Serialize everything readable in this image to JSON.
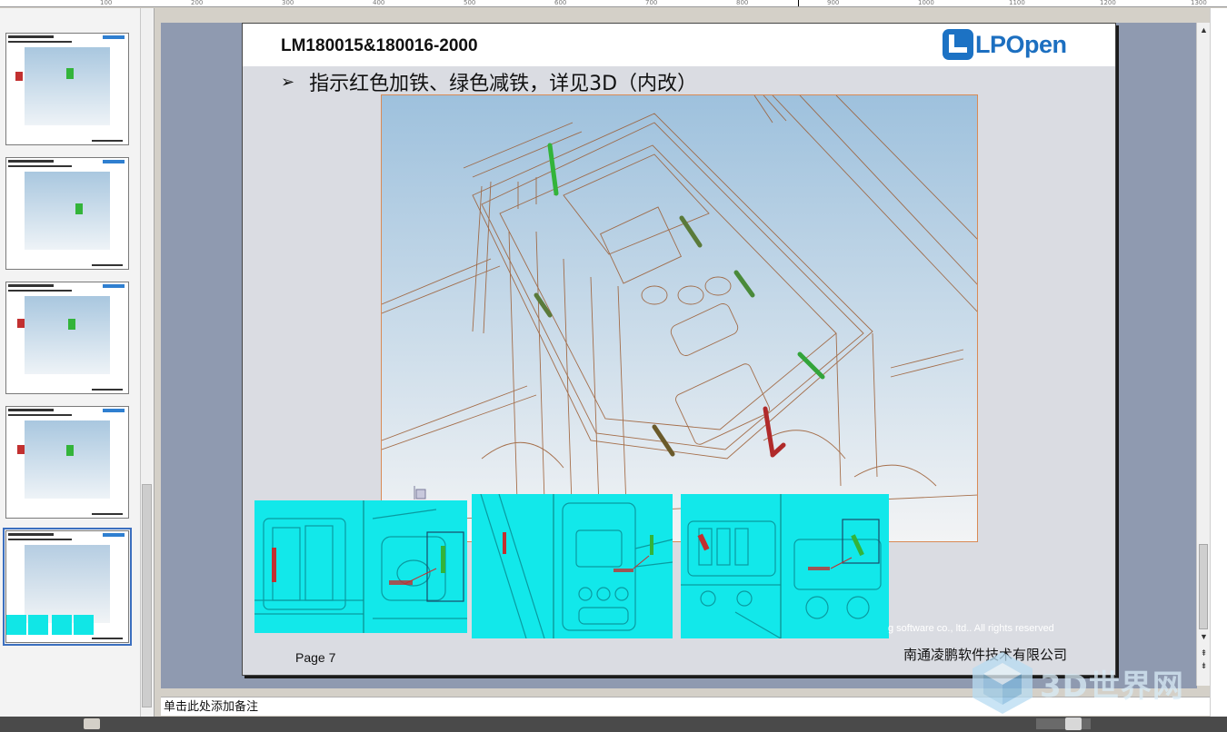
{
  "ruler": {
    "ticks": [
      "100",
      "200",
      "300",
      "400",
      "500",
      "600",
      "700",
      "800",
      "900",
      "1000",
      "1100",
      "1200",
      "1300"
    ]
  },
  "thumbnails": {
    "count": 5,
    "selected_index": 5
  },
  "slide": {
    "title": "LM180015&180016-2000",
    "logo_text": "LPOpen",
    "bullet_symbol": "➢",
    "bullet_text": "指示红色加铁、绿色减铁，详见3D（内改）",
    "copyright": "g software co., ltd.. All rights reserved",
    "page_label": "Page 7",
    "company": "南通凌鹏软件技术有限公司"
  },
  "notes": {
    "placeholder": "单击此处添加备注"
  },
  "watermark": {
    "text": "3D世界网"
  },
  "colors": {
    "slide_area_bg": "#8f9ab0",
    "accent_blue": "#1c72c4",
    "cyan_render": "#12e8ea",
    "red_add": "#c23030",
    "green_remove": "#33b43a"
  }
}
